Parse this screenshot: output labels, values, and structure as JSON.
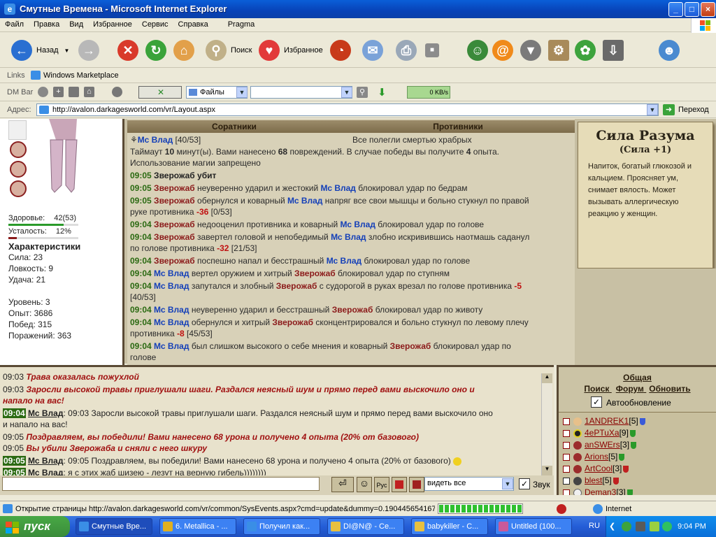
{
  "window": {
    "title": "Смутные Времена - Microsoft Internet Explorer",
    "min": "_",
    "max": "□",
    "close": "×"
  },
  "menu": [
    "Файл",
    "Правка",
    "Вид",
    "Избранное",
    "Сервис",
    "Справка",
    "Pragma"
  ],
  "toolbar": {
    "back": "Назад",
    "search": "Поиск",
    "favorites": "Избранное"
  },
  "links": {
    "label": "Links",
    "item": "Windows Marketplace"
  },
  "dmbar": {
    "label": "DM Bar",
    "select": "Файлы",
    "speed": "0 KB/s"
  },
  "address": {
    "label": "Адрес:",
    "url": "http://avalon.darkagesworld.com/vr/Layout.aspx",
    "go": "Переход"
  },
  "char": {
    "health": "Здоровье:",
    "health_val": "42(53)",
    "fatigue": "Усталость:",
    "fatigue_val": "12%",
    "health_pct": 0.79,
    "fatigue_pct": 0.12,
    "title": "Характеристики",
    "strength": "Сила: 23",
    "agility": "Ловкость: 9",
    "luck": "Удача: 21",
    "level": "Уровень: 3",
    "exp": "Опыт: 3686",
    "wins": "Побед: 315",
    "losses": "Поражений: 363"
  },
  "battle": {
    "allies": "Соратники",
    "enemies": "Противники",
    "player": "Мс Влад",
    "player_hp": "[40/53]",
    "enemies_status": "Все полегли смертью храбрых",
    "timeout": "Таймаут",
    "timeout_n": "10",
    "timeout_rest": "минут(ы). Вами нанесено",
    "dmg": "68",
    "dmg_rest": "повреждений. В случае победы вы получите",
    "exp": "4",
    "exp_rest": "опыта.",
    "nomagic": "Использование магии запрещено"
  },
  "log": [
    {
      "time": "09:05",
      "a": "Зверожаб убит"
    },
    {
      "time": "09:05",
      "e1": "Зверожаб",
      "t1": "неуверенно ударил и жестокий",
      "m1": "Мс Влад",
      "t2": "блокировал удар по бедрам"
    },
    {
      "time": "09:05",
      "e1": "Зверожаб",
      "t1": "обернулся и коварный",
      "m1": "Мс Влад",
      "t2": "напряг все свои мышцы и больно стукнул по правой",
      "l2": "руке противника",
      "dmg": "-36",
      "hp": "[0/53]"
    },
    {
      "time": "09:04",
      "e1": "Зверожаб",
      "t1": "недооценил противника и коварный",
      "m1": "Мс Влад",
      "t2": "блокировал удар по голове"
    },
    {
      "time": "09:04",
      "e1": "Зверожаб",
      "t1": "завертел головой и непобедимый",
      "m1": "Мс Влад",
      "t2": "злобно искривившись наотмашь саданул",
      "l2": "по голове противника",
      "dmg": "-32",
      "hp": "[21/53]"
    },
    {
      "time": "09:04",
      "e1": "Зверожаб",
      "t1": "поспешно напал и бесстрашный",
      "m1": "Мс Влад",
      "t2": "блокировал удар по голове"
    },
    {
      "time": "09:04",
      "m0": "Мс Влад",
      "t1": "вертел оружием и хитрый",
      "e2": "Зверожаб",
      "t2": "блокировал удар по ступням"
    },
    {
      "time": "09:04",
      "m0": "Мс Влад",
      "t1": "запутался и злобный",
      "e2": "Зверожаб",
      "t2": "с судорогой в руках врезал по голове противника",
      "dmg": "-5",
      "l2": "[40/53]"
    },
    {
      "time": "09:04",
      "m0": "Мс Влад",
      "t1": "неуверенно ударил и бесстрашный",
      "e2": "Зверожаб",
      "t2": "блокировал удар по животу"
    },
    {
      "time": "09:04",
      "m0": "Мс Влад",
      "t1": "обернулся и хитрый",
      "e2": "Зверожаб",
      "t2": "сконцентрировался и больно стукнул по левому плечу",
      "l2": "противника",
      "dmg": "-8",
      "hp": "[45/53]"
    },
    {
      "time": "09:04",
      "m0": "Мс Влад",
      "t1": "был слишком высокого о себе мнения и коварный",
      "e2": "Зверожаб",
      "t2": "блокировал удар по",
      "l2": "голове"
    }
  ],
  "scroll": {
    "title": "Сила Разума",
    "subtitle": "(Сила +1)",
    "desc": "Напиток, богатый глюкозой и кальцием. Проясняет ум, снимает вялость. Может вызывать аллергическую реакцию у женщин."
  },
  "chat": [
    {
      "time": "09:03",
      "red": "Трава оказалась пожухлой"
    },
    {
      "time": "09:03",
      "red": "Заросли высокой травы приглушали шаги. Раздался неясный шум и прямо перед вами выскочило оно и",
      "red2": "напало на вас!"
    },
    {
      "badge": "09:04",
      "name": "Мс Влад",
      "text": "09:03 Заросли высокой травы приглушали шаги. Раздался неясный шум и прямо перед вами выскочило оно",
      "text2": "и напало на вас!"
    },
    {
      "time": "09:05",
      "red": "Поздравляем, вы победили! Вами нанесено 68 урона и получено 4 опыта (20% от базового)"
    },
    {
      "time": "09:05",
      "red": "Вы убили Зверожаба и сняли с него шкуру"
    },
    {
      "badge": "09:05",
      "name": "Мс Влад",
      "text": "09:05 Поздравляем, вы победили! Вами нанесено 68 урона и получено 4 опыта (20% от базового)"
    },
    {
      "badge": "09:05",
      "name": "Мс Влад",
      "text": "я с этих жаб шизею - лезут на верную гибель))))))))"
    }
  ],
  "chatctl": {
    "select": "видеть все",
    "sound": "Звук",
    "translit": "Рус"
  },
  "online": {
    "tab": "Общая",
    "search": "Поиск",
    "forum": "Форум",
    "refresh": "Обновить",
    "autorefresh": "Автообновление",
    "users": [
      {
        "name": "1ANDREK1",
        "lvl": "[5]"
      },
      {
        "name": "4ePTuXa",
        "lvl": "[9]"
      },
      {
        "name": "anSWErs",
        "lvl": "[3]"
      },
      {
        "name": "Arions",
        "lvl": "[5]"
      },
      {
        "name": "ArtCool",
        "lvl": "[3]"
      },
      {
        "name": "blest",
        "lvl": "[5]"
      },
      {
        "name": "Deman3",
        "lvl": "[3]"
      }
    ]
  },
  "status": {
    "text": "Открытие страницы http://avalon.darkagesworld.com/vr/common/SysEvents.aspx?cmd=update&dummy=0.190445654167",
    "zone": "Internet"
  },
  "taskbar": {
    "start": "пуск",
    "tasks": [
      "Смутные Вре...",
      "6. Metallica - ...",
      "Получил как...",
      "DI@N@ - Се...",
      "babykiller - С...",
      "Untitled (100..."
    ],
    "lang": "RU",
    "clock": "9:04 PM"
  }
}
